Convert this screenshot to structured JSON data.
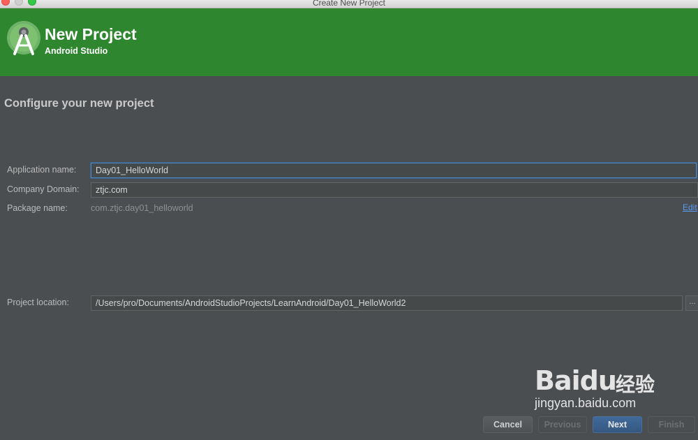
{
  "window": {
    "title": "Create New Project"
  },
  "banner": {
    "title": "New Project",
    "subtitle": "Android Studio",
    "logo_icon": "android-studio-logo-icon",
    "background_color": "#2e872f"
  },
  "page": {
    "heading": "Configure your new project"
  },
  "form": {
    "application_name": {
      "label": "Application name:",
      "value": "Day01_HelloWorld"
    },
    "company_domain": {
      "label": "Company Domain:",
      "value": "ztjc.com"
    },
    "package_name": {
      "label": "Package name:",
      "value": "com.ztjc.day01_helloworld",
      "edit_label": "Edit"
    },
    "project_location": {
      "label": "Project location:",
      "value": "/Users/pro/Documents/AndroidStudioProjects/LearnAndroid/Day01_HelloWorld2",
      "browse_label": "..."
    }
  },
  "footer": {
    "cancel_label": "Cancel",
    "previous_label": "Previous",
    "next_label": "Next",
    "finish_label": "Finish"
  },
  "watermark": {
    "brand": "Bai",
    "brand_suffix": "du",
    "brand_cn": "经验",
    "url": "jingyan.baidu.com"
  }
}
